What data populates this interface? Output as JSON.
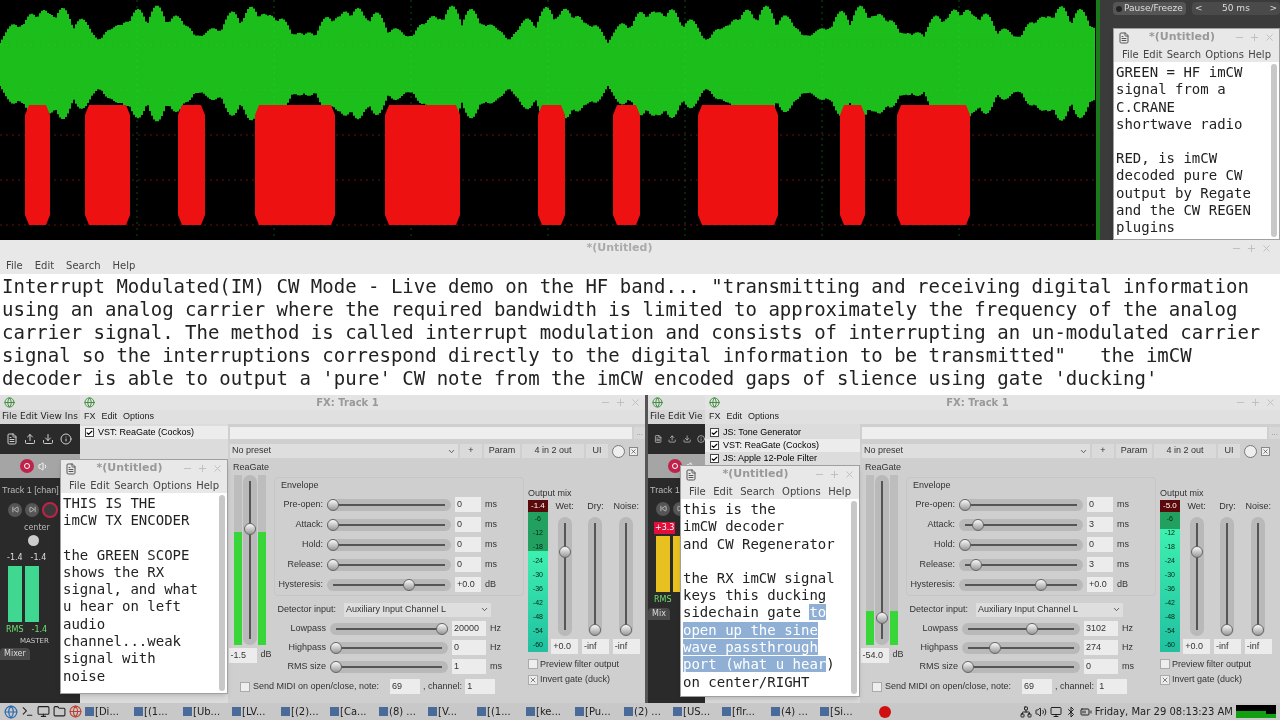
{
  "scope": {
    "pause_button": "Pause/Freeze",
    "timebase": {
      "prev": "<",
      "value": "50 ms",
      "next": ">"
    }
  },
  "top_note": {
    "title": "*(Untitled)",
    "menu": [
      "File",
      "Edit",
      "Search",
      "Options",
      "Help"
    ],
    "paragraphs": [
      [
        [
          {
            "text": "GREEN = HF imCW",
            "selected": false
          }
        ],
        [
          {
            "text": "signal from a",
            "selected": false
          }
        ],
        [
          {
            "text": "C.CRANE",
            "selected": false
          }
        ],
        [
          {
            "text": "shortwave radio",
            "selected": false
          }
        ]
      ],
      [
        [
          {
            "text": "RED, is imCW",
            "selected": false
          }
        ],
        [
          {
            "text": "decoded pure CW",
            "selected": false
          }
        ],
        [
          {
            "text": "output by Regate",
            "selected": false
          }
        ],
        [
          {
            "text": "and the CW REGEN",
            "selected": false
          }
        ],
        [
          {
            "text": "plugins",
            "selected": false
          }
        ]
      ]
    ]
  },
  "main_editor": {
    "title": "*(Untitled)",
    "menu": [
      "File",
      "Edit",
      "Search",
      "Help"
    ],
    "lines": [
      "Interrupt Modulated(IM) CW Mode - Live demo on the HF band... \"transmitting and receiving digital information",
      "using an analog carrier where the required bandwidth is limited to approximately the frequency of the analog",
      "carrier signal. The method is called interrupt modulation and consists of interrupting an un-modulated carrier",
      "signal so the interruptions correspond directly to the digital information to be transmitted\"   the imCW",
      "decoder is able to output a 'pure' CW note from the imCW encoded gaps of slience using gate 'ducking'"
    ]
  },
  "panels": [
    {
      "reaper": {
        "menu": [
          "File",
          "Edit",
          "View",
          "Ins"
        ],
        "track_label": "Track 1 [chan]",
        "pan_label": "center",
        "peaks": [
          "-1.4",
          "-1.4"
        ],
        "rms_label": "RMS",
        "rms_value": "-1.4",
        "master_label": "MASTER",
        "mixer_tab": "Mixer",
        "clipped": false
      },
      "fx": {
        "title": "FX: Track 1",
        "menu": [
          "FX",
          "Edit",
          "Options"
        ],
        "plugins": [
          {
            "name": "VST: ReaGate (Cockos)",
            "enabled": true,
            "selected": true
          }
        ],
        "more_button": "...",
        "preset": "No preset",
        "enabled": true,
        "buttons": [
          "+",
          "Param",
          "4 in 2 out",
          "UI"
        ],
        "plugin_name": "ReaGate",
        "threshold": {
          "value": "-1.5",
          "unit": "dB",
          "level": 0.69,
          "signal": {
            "level": 0.66
          }
        },
        "envelope": {
          "title": "Envelope",
          "rows": [
            {
              "label": "Pre-open:",
              "value": "0",
              "unit": "ms",
              "level": 0
            },
            {
              "label": "Attack:",
              "value": "0",
              "unit": "ms",
              "level": 0
            },
            {
              "label": "Hold:",
              "value": "0",
              "unit": "ms",
              "level": 0
            },
            {
              "label": "Release:",
              "value": "0",
              "unit": "ms",
              "level": 0
            },
            {
              "label": "Hysteresis:",
              "value": "+0.0",
              "unit": "dB",
              "level": 0.68
            }
          ]
        },
        "detector": {
          "label": "Detector input:",
          "value": "Auxiliary Input Channel L"
        },
        "filters": [
          {
            "label": "Lowpass",
            "value": "20000",
            "unit": "Hz",
            "level": 1
          },
          {
            "label": "Highpass",
            "value": "0",
            "unit": "Hz",
            "level": 0
          },
          {
            "label": "RMS size",
            "value": "1",
            "unit": "ms",
            "level": 0
          }
        ],
        "midi": {
          "label": "Send MIDI on open/close, note:",
          "checked": false,
          "note": "69",
          "channel_label": ", channel:",
          "channel": "1"
        },
        "output": {
          "title": "Output mix",
          "reading": "-1.4",
          "meter": {
            "level": 0.72
          },
          "ticks": [
            "-6",
            "-12",
            "-18",
            "-24",
            "-30",
            "-36",
            "-42",
            "-48",
            "-54",
            "-60"
          ],
          "faders": [
            {
              "label": "Wet:",
              "value": "+0.0",
              "level": 0.72
            },
            {
              "label": "Dry:",
              "value": "-inf",
              "level": 0
            },
            {
              "label": "Noise:",
              "value": "-inf",
              "level": 0
            }
          ],
          "options": [
            {
              "label": "Preview filter output",
              "checked": false
            },
            {
              "label": "Invert gate (duck)",
              "checked": true
            }
          ]
        }
      },
      "note": {
        "title": "*(Untitled)",
        "menu": [
          "File",
          "Edit",
          "Search",
          "Options",
          "Help"
        ],
        "paragraphs": [
          [
            [
              {
                "text": "THIS IS THE",
                "selected": false
              }
            ],
            [
              {
                "text": "imCW TX ENCODER",
                "selected": false
              }
            ]
          ],
          [
            [
              {
                "text": "the GREEN SCOPE",
                "selected": false
              }
            ],
            [
              {
                "text": "shows the RX",
                "selected": false
              }
            ],
            [
              {
                "text": "signal, and what",
                "selected": false
              }
            ],
            [
              {
                "text": "u hear on left",
                "selected": false
              }
            ],
            [
              {
                "text": "audio",
                "selected": false
              }
            ],
            [
              {
                "text": "channel...weak",
                "selected": false
              }
            ],
            [
              {
                "text": "signal with",
                "selected": false
              }
            ],
            [
              {
                "text": "noise",
                "selected": false
              }
            ]
          ]
        ]
      }
    },
    {
      "reaper": {
        "menu": [
          "File",
          "Edit",
          "Vie"
        ],
        "track_label": "Track 1",
        "peaks": [
          "+3.3"
        ],
        "rms_label": "RMS",
        "mixer_tab": "Mix",
        "clipped": true
      },
      "fx": {
        "title": "FX: Track 1",
        "menu": [
          "FX",
          "Edit",
          "Options"
        ],
        "plugins": [
          {
            "name": "JS: Tone Generator",
            "enabled": true,
            "selected": false
          },
          {
            "name": "VST: ReaGate (Cockos)",
            "enabled": true,
            "selected": true
          },
          {
            "name": "JS: Apple 12-Pole Filter",
            "enabled": true,
            "selected": false
          }
        ],
        "more_button": "...",
        "preset": "No preset",
        "enabled": true,
        "buttons": [
          "+",
          "Param",
          "4 in 2 out",
          "UI"
        ],
        "plugin_name": "ReaGate",
        "threshold": {
          "value": "-54.0",
          "unit": "dB",
          "level": 0.13,
          "signal": {
            "level": 0.2
          }
        },
        "envelope": {
          "title": "Envelope",
          "rows": [
            {
              "label": "Pre-open:",
              "value": "0",
              "unit": "ms",
              "level": 0
            },
            {
              "label": "Attack:",
              "value": "3",
              "unit": "ms",
              "level": 0.12
            },
            {
              "label": "Hold:",
              "value": "0",
              "unit": "ms",
              "level": 0
            },
            {
              "label": "Release:",
              "value": "3",
              "unit": "ms",
              "level": 0.1
            },
            {
              "label": "Hysteresis:",
              "value": "+0.0",
              "unit": "dB",
              "level": 0.68
            }
          ]
        },
        "detector": {
          "label": "Detector input:",
          "value": "Auxiliary Input Channel L"
        },
        "filters": [
          {
            "label": "Lowpass",
            "value": "3102",
            "unit": "Hz",
            "level": 0.6
          },
          {
            "label": "Highpass",
            "value": "274",
            "unit": "Hz",
            "level": 0.25
          },
          {
            "label": "RMS size",
            "value": "0",
            "unit": "ms",
            "level": 0
          }
        ],
        "midi": {
          "label": "Send MIDI on open/close, note:",
          "checked": false,
          "note": "69",
          "channel_label": ", channel:",
          "channel": "1"
        },
        "output": {
          "title": "Output mix",
          "reading": "-5.0",
          "meter": {
            "level": 0.88
          },
          "ticks": [
            "-6",
            "-12",
            "-18",
            "-24",
            "-30",
            "-36",
            "-42",
            "-48",
            "-54",
            "-60"
          ],
          "faders": [
            {
              "label": "Wet:",
              "value": "+0.0",
              "level": 0.72
            },
            {
              "label": "Dry:",
              "value": "-inf",
              "level": 0
            },
            {
              "label": "Noise:",
              "value": "-inf",
              "level": 0
            }
          ],
          "options": [
            {
              "label": "Preview filter output",
              "checked": false
            },
            {
              "label": "Invert gate (duck)",
              "checked": true
            }
          ]
        }
      },
      "note": {
        "title": "*(Untitled)",
        "menu": [
          "File",
          "Edit",
          "Search",
          "Options",
          "Help"
        ],
        "paragraphs": [
          [
            [
              {
                "text": "this is the",
                "selected": false
              }
            ],
            [
              {
                "text": "imCW decoder",
                "selected": false
              }
            ],
            [
              {
                "text": "and CW Regenerator",
                "selected": false
              }
            ]
          ],
          [
            [
              {
                "text": "the RX imCW signal",
                "selected": false
              }
            ],
            [
              {
                "text": "keys this ducking",
                "selected": false
              }
            ],
            [
              {
                "text": "sidechain gate ",
                "selected": false
              },
              {
                "text": "to",
                "selected": true
              }
            ],
            [
              {
                "text": "open up the sine",
                "selected": true
              }
            ],
            [
              {
                "text": "wave passthrough",
                "selected": true
              }
            ],
            [
              {
                "text": "port (what u hear",
                "selected": true
              },
              {
                "text": ")",
                "selected": false
              }
            ],
            [
              {
                "text": "on center/RIGHT",
                "selected": false
              }
            ]
          ]
        ]
      }
    }
  ],
  "taskbar": {
    "tasks": [
      "[Di...",
      "[(1...",
      "[Ub...",
      "[LV...",
      "[(2)...",
      "[Ca...",
      "(8) ...",
      "[V...",
      "[(1...",
      "[ke...",
      "[Pu...",
      "(2) ...",
      "[US...",
      "[flr...",
      "(4) ...",
      "[Si..."
    ],
    "clock": "Friday, Mar 29 08:13:23 AM"
  }
}
